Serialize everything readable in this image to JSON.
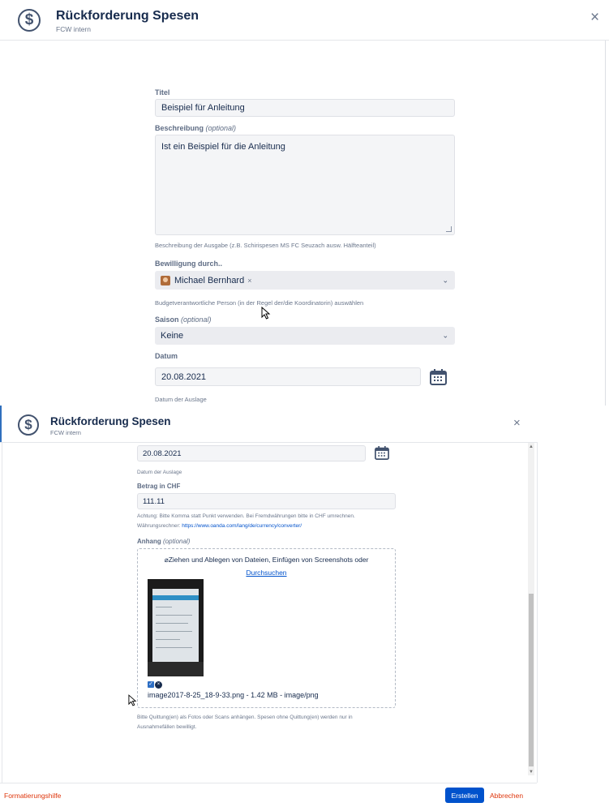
{
  "panel1": {
    "dialog": {
      "title": "Rückforderung Spesen",
      "subtitle": "FCW intern",
      "close_symbol": "×",
      "icon": "dollar-icon"
    },
    "form": {
      "titel": {
        "label": "Titel",
        "value": "Beispiel für Anleitung"
      },
      "beschreibung": {
        "label": "Beschreibung",
        "optional": "(optional)",
        "value": "Ist ein Beispiel für die Anleitung",
        "help": "Beschreibung der Ausgabe (z.B. Schirispesen MS FC Seuzach ausw. Hälfteanteil)"
      },
      "bewilligung": {
        "label": "Bewilligung durch..",
        "selected_user": "Michael Bernhard",
        "remove_symbol": "×",
        "help": "Budgetverantwortliche Person (in der Regel der/die Koordinatorin) auswählen"
      },
      "saison": {
        "label": "Saison",
        "optional": "(optional)",
        "value": "Keine"
      },
      "datum": {
        "label": "Datum",
        "value": "20.08.2021",
        "help": "Datum der Auslage"
      }
    }
  },
  "panel2": {
    "dialog": {
      "title": "Rückforderung Spesen",
      "subtitle": "FCW intern",
      "close_symbol": "×"
    },
    "form": {
      "datum": {
        "value": "20.08.2021",
        "help": "Datum der Auslage"
      },
      "betrag": {
        "label": "Betrag in CHF",
        "value": "111.11",
        "help_line1": "Achtung: Bitte Komma statt Punkt verwenden. Bei Fremdwährungen bitte in CHF umrechnen.",
        "help_line2_prefix": "Währungsrechner: ",
        "help_link": "https://www.oanda.com/lang/de/currency/converter/"
      },
      "anhang": {
        "label": "Anhang",
        "optional": "(optional)",
        "drop_text": "Ziehen und Ablegen von Dateien, Einfügen von Screenshots oder",
        "browse_link": "Durchsuchen",
        "file_name": "image2017-8-25_18-9-33.png - 1.42 MB - image/png",
        "help_line1": "Bitte Quittung(en) als Fotos oder Scans anhängen. Spesen ohne Quittung(en) werden nur in",
        "help_line2": "Ausnahmefällen bewilligt."
      }
    },
    "footer": {
      "format_help": "Formatierungshilfe",
      "create_button": "Erstellen",
      "cancel_button": "Abbrechen"
    },
    "colors": {
      "primary": "#0052cc",
      "danger": "#de350b",
      "link": "#0052cc"
    }
  }
}
